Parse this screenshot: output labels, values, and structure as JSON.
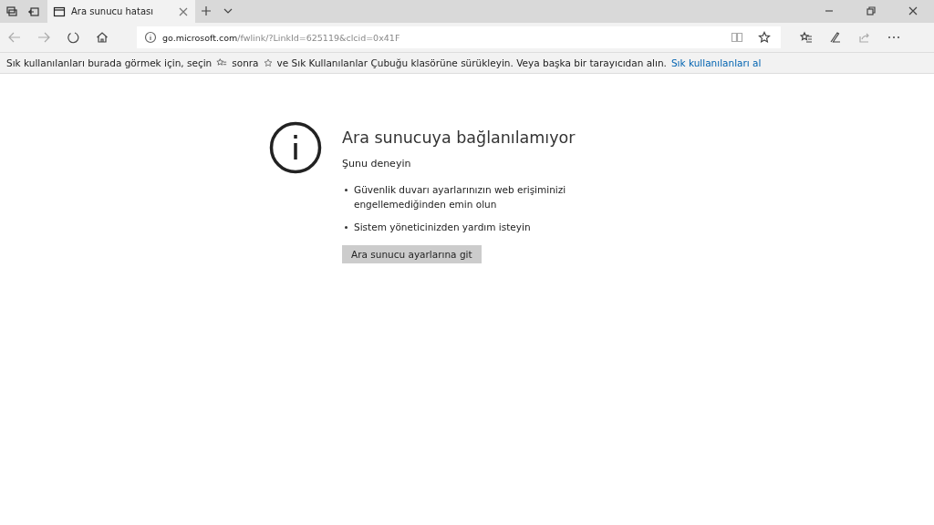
{
  "tabs": [
    {
      "title": "Ara sunucu hatası",
      "selected": true
    }
  ],
  "address_bar": {
    "host": "go.microsoft.com",
    "path": "/fwlink/?LinkId=625119&clcid=0x41F"
  },
  "favorites_bar": {
    "text_before": "Sık kullanılanları burada görmek için, seçin",
    "text_middle": "sonra",
    "text_after": "ve Sık Kullanılanlar Çubuğu klasörüne sürükleyin. Veya başka bir tarayıcıdan alın.",
    "link": "Sık kullanılanları al"
  },
  "error": {
    "title": "Ara sunucuya bağlanılamıyor",
    "subtitle": "Şunu deneyin",
    "suggestions": [
      "Güvenlik duvarı ayarlarınızın web erişiminizi engellemediğinden emin olun",
      "Sistem yöneticinizden yardım isteyin"
    ],
    "button": "Ara sunucu ayarlarına git"
  }
}
